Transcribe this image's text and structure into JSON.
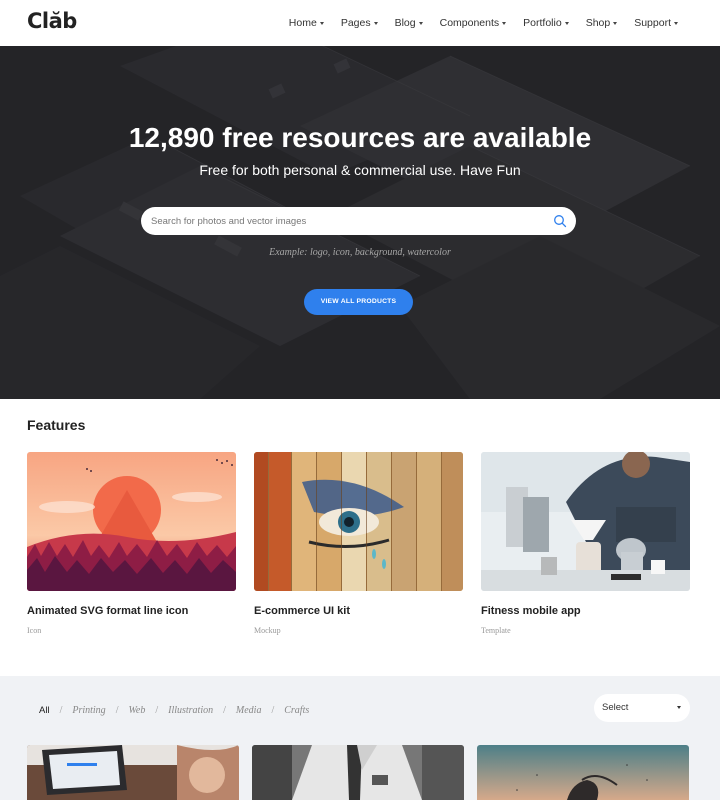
{
  "brand": {
    "logo": "Clăb"
  },
  "nav": {
    "items": [
      {
        "label": "Home"
      },
      {
        "label": "Pages"
      },
      {
        "label": "Blog"
      },
      {
        "label": "Components"
      },
      {
        "label": "Portfolio"
      },
      {
        "label": "Shop"
      },
      {
        "label": "Support"
      }
    ]
  },
  "hero": {
    "title": "12,890 free resources are available",
    "subtitle": "Free for both personal & commercial use. Have Fun",
    "search_placeholder": "Search for photos and vector images",
    "example": "Example: logo, icon, background, watercolor",
    "cta": "VIEW ALL PRODUCTS"
  },
  "features": {
    "title": "Features",
    "cards": [
      {
        "title": "Animated SVG format line icon",
        "tag": "Icon"
      },
      {
        "title": "E-commerce UI kit",
        "tag": "Mockup"
      },
      {
        "title": "Fitness mobile app",
        "tag": "Template"
      }
    ]
  },
  "portfolio": {
    "filters": [
      {
        "label": "All"
      },
      {
        "label": "Printing"
      },
      {
        "label": "Web"
      },
      {
        "label": "Illustration"
      },
      {
        "label": "Media"
      },
      {
        "label": "Crafts"
      }
    ],
    "select": "Select"
  },
  "colors": {
    "accent": "#2f80ed",
    "hero_bg": "#2b2b2e",
    "section_bg": "#f0f2f5"
  }
}
